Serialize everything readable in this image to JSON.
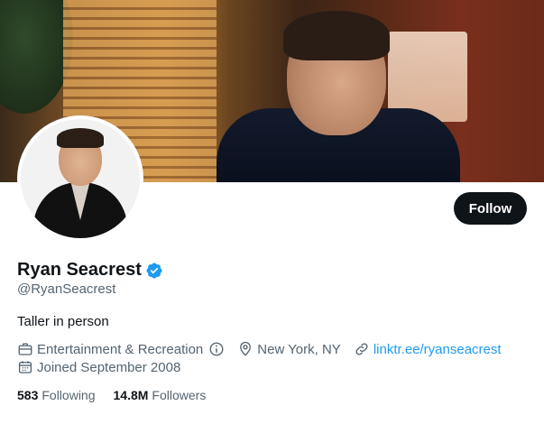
{
  "profile": {
    "display_name": "Ryan Seacrest",
    "handle": "@RyanSeacrest",
    "bio": "Taller in person",
    "category": "Entertainment & Recreation",
    "location": "New York, NY",
    "website": "linktr.ee/ryanseacrest",
    "joined": "Joined September 2008"
  },
  "actions": {
    "follow_label": "Follow"
  },
  "stats": {
    "following_count": "583",
    "following_label": "Following",
    "followers_count": "14.8M",
    "followers_label": "Followers"
  },
  "icons": {
    "verified": "verified-badge-icon",
    "category": "briefcase-icon",
    "info": "info-icon",
    "location": "location-pin-icon",
    "link": "link-icon",
    "calendar": "calendar-icon"
  },
  "colors": {
    "verified": "#1d9bf0",
    "link": "#1d9bf0",
    "button_bg": "#0f1419",
    "secondary_text": "#536471"
  }
}
